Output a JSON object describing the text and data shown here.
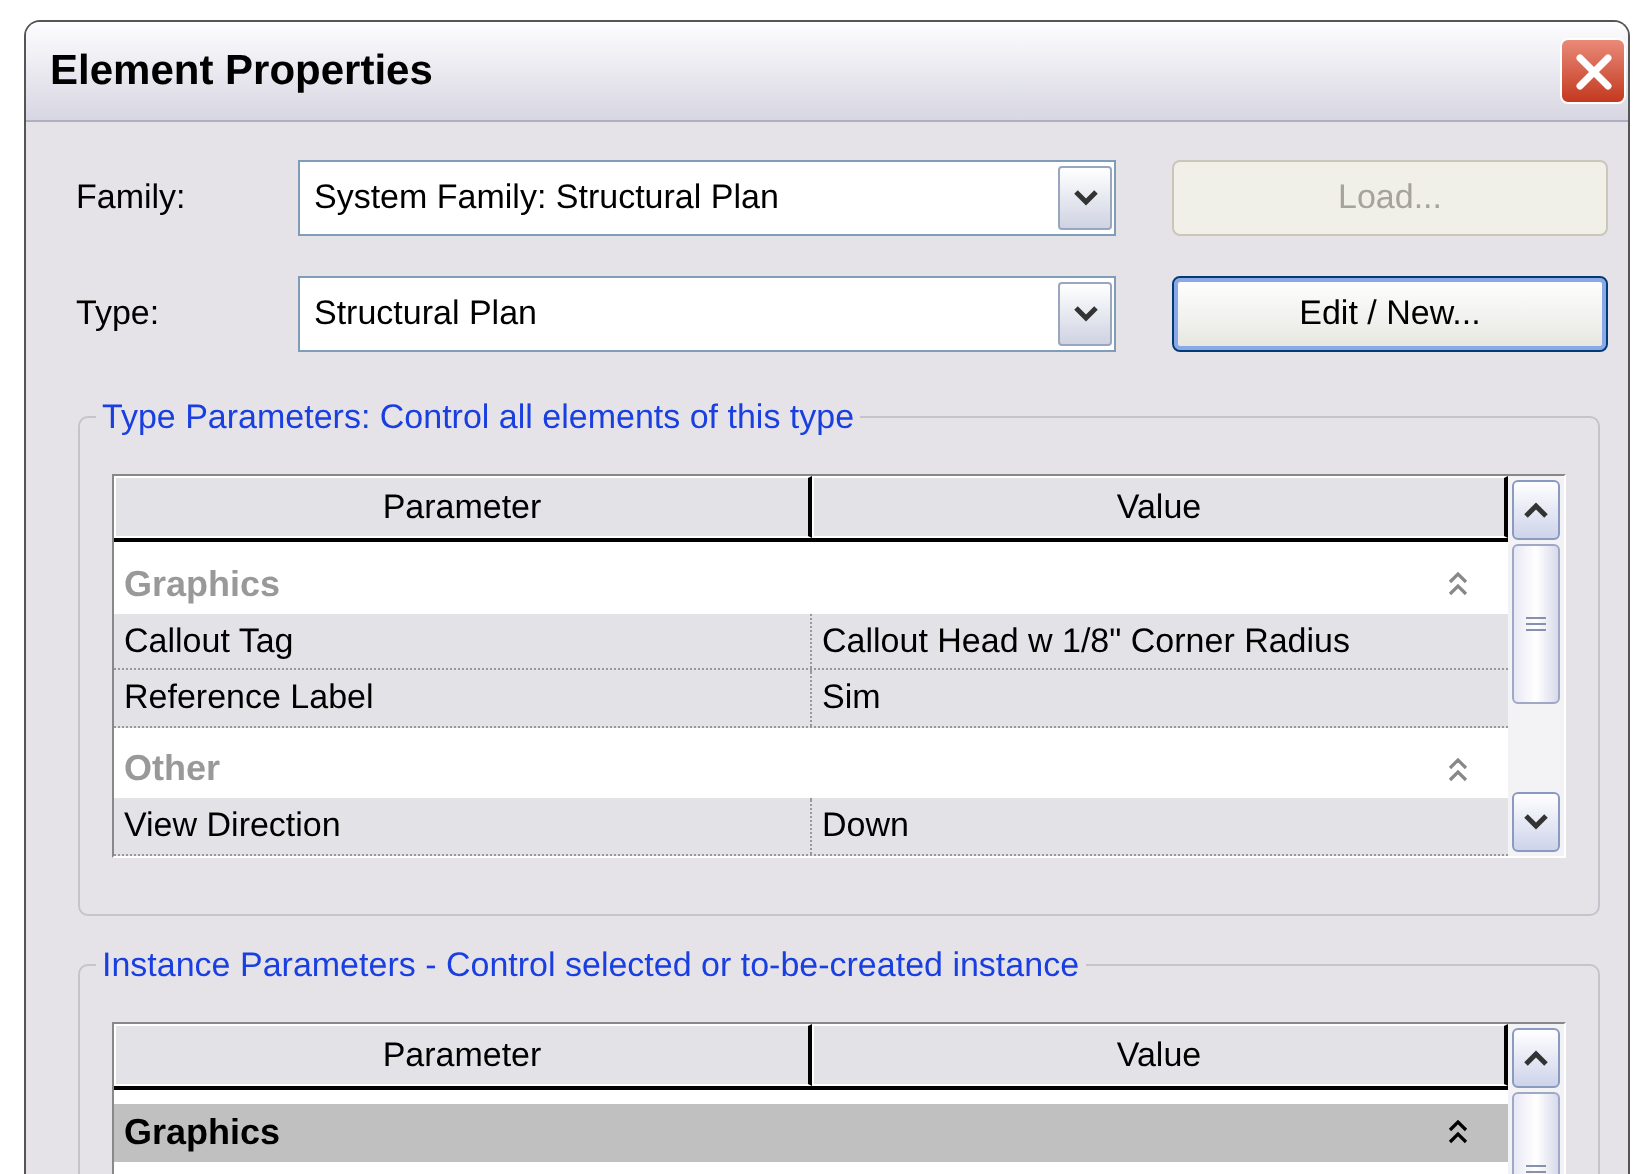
{
  "window": {
    "title": "Element Properties"
  },
  "fields": [
    {
      "label": "Family:",
      "value": "System Family: Structural Plan",
      "button": {
        "label": "Load...",
        "disabled": true,
        "default": false
      }
    },
    {
      "label": "Type:",
      "value": "Structural Plan",
      "button": {
        "label": "Edit / New...",
        "disabled": false,
        "default": true
      }
    }
  ],
  "sections": [
    {
      "title": "Type Parameters: Control all elements of this type",
      "columns": [
        "Parameter",
        "Value"
      ],
      "rows": [
        {
          "kind": "group",
          "label": "Graphics",
          "selected": false
        },
        {
          "kind": "param",
          "parameter": "Callout Tag",
          "value": "Callout Head w 1/8\" Corner Radius",
          "selected": false
        },
        {
          "kind": "param",
          "parameter": "Reference Label",
          "value": "Sim",
          "selected": false
        },
        {
          "kind": "group",
          "label": "Other",
          "selected": false
        },
        {
          "kind": "param",
          "parameter": "View Direction",
          "value": "Down",
          "selected": false
        }
      ]
    },
    {
      "title": "Instance Parameters - Control selected or to-be-created instance",
      "columns": [
        "Parameter",
        "Value"
      ],
      "rows": [
        {
          "kind": "group",
          "label": "Graphics",
          "selected": true
        }
      ]
    }
  ]
}
